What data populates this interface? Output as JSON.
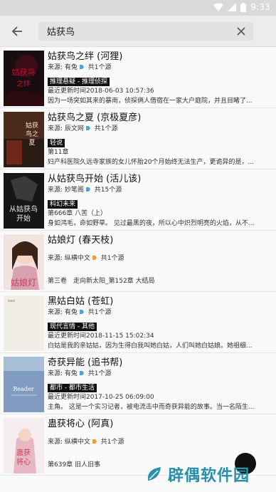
{
  "status": {
    "time": "9:33"
  },
  "search": {
    "query": "姑获鸟",
    "clear_symbol": "✕"
  },
  "results": [
    {
      "title": "姑获鸟之绊 (河狸)",
      "source": "来源: 有兔",
      "source_count": "共1个源",
      "badge": "推理悬疑 - 推理侦探",
      "updated": "最近更新时间2018-06-03 10:57:36",
      "desc": "因为一场突如其来的暴雨，侦探俩人借宿在一家大户庭院，并且目睹了..."
    },
    {
      "title": "姑获鸟之夏 (京极夏彦)",
      "source": "来源: 辰文网",
      "source_count": "共1个源",
      "badge": "轻说",
      "updated": "第11章",
      "desc": "妇产科医院久远寺家族的女儿怀胎20个月始终无法生产，更诡异的是，..."
    },
    {
      "title": "从姑获鸟开始 (活儿该)",
      "source": "来源: 妙笔阁",
      "source_count": "共15个源",
      "badge": "科幻未来",
      "updated": "第666章 八苦（上）",
      "desc": "身如鸿毛，命如野草。 见过最黑的夜，所以心中炽烈明亮的火焰，从不..."
    },
    {
      "title": "姑娘灯 (春天枝)",
      "source": "来源: 纵横中文",
      "source_count": "共1个源",
      "badge": "",
      "updated": "",
      "desc": "第三卷　走向新太阳_第152章 大结局"
    },
    {
      "title": "黑姑白姑 (苍虹)",
      "source": "来源: 有兔",
      "source_count": "共1个源",
      "badge": "现代言情 - 其他",
      "updated": "最近更新时间2018-11-15 15:02:34",
      "desc": "白姑是我的亲姑姑，因为生得白我叫她白姑，人们叫她白姑娘。她祖细..."
    },
    {
      "title": "奇获异能 (追书帮)",
      "source": "来源: 有兔",
      "source_count": "共1个源",
      "badge": "都市 - 都市生活",
      "updated": "最近更新时间2017-10-25 06:09:00",
      "desc": "主角。 这是一个实习记者，被电流击中而奇获异能的故事。当一名陌生..."
    },
    {
      "title": "蛊获将心 (阿真)",
      "source": "来源: 纵横中文",
      "source_count": "共1个源",
      "badge": "",
      "updated": "",
      "desc": "第639章 旧人旧事"
    }
  ],
  "covers": [
    {
      "text": "姑获鸟之绊",
      "bg": "#1a0d12",
      "fg": "#c0102a"
    },
    {
      "text": "姑获鸟之夏",
      "bg": "#2a1a14",
      "fg": "#f3e4d0"
    },
    {
      "text": "从姑获鸟开始",
      "bg": "#161616",
      "fg": "#e8e8e8"
    },
    {
      "text": "姑娘灯",
      "bg": "#f2e3e0",
      "fg": "#c4405a"
    },
    {
      "text": "",
      "bg": "#f1eee6",
      "fg": "#bbb"
    },
    {
      "text": "Reader",
      "bg": "#7f9cc0",
      "fg": "#ffffff"
    },
    {
      "text": "蛊获将心",
      "bg": "#f4ecef",
      "fg": "#c8425e"
    }
  ],
  "watermark": {
    "text": "辟偶软件园"
  },
  "colors": {
    "accent": "#2a8fa8",
    "badge": "#111111",
    "source_tag": "#e9a23b"
  }
}
